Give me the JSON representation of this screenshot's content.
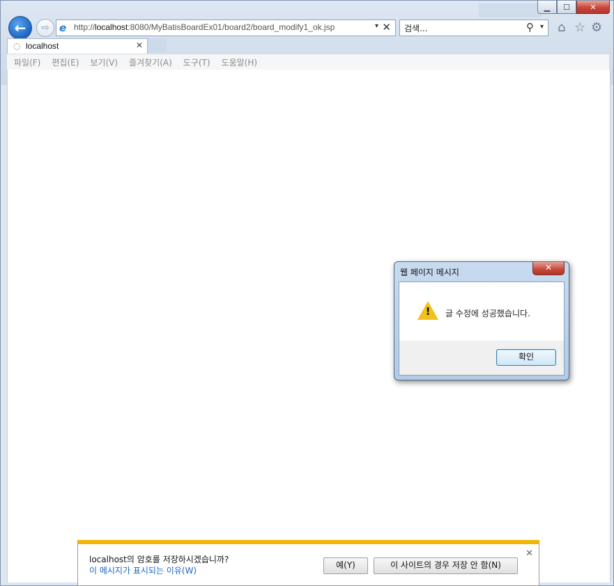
{
  "window": {
    "controls": {
      "minimize": "▁",
      "maximize": "☐",
      "close": "✕"
    }
  },
  "nav": {
    "back_glyph": "←",
    "forward_glyph": "⇨",
    "address": {
      "url_prefix": "http://",
      "url_host": "localhost",
      "url_rest": ":8080/MyBatisBoardEx01/board2/board_modify1_ok.jsp",
      "dropdown": "▾",
      "stop": "✕"
    },
    "search": {
      "placeholder": "검색...",
      "icon": "⚲",
      "dropdown": "▾"
    },
    "tools": {
      "home_icon": "⌂",
      "favorites_icon": "☆",
      "settings_icon": "⚙"
    }
  },
  "tab": {
    "label": "localhost",
    "spinner": "◌",
    "close": "✕"
  },
  "menu": [
    "파일(F)",
    "편집(E)",
    "보기(V)",
    "즐겨찾기(A)",
    "도구(T)",
    "도움말(H)"
  ],
  "dialog": {
    "title": "웹 페이지 메시지",
    "close": "✕",
    "icon": "warning-icon",
    "message": "글 수정에 성공했습니다.",
    "ok_label": "확인"
  },
  "notification": {
    "message": "localhost의 암호를 저장하시겠습니까?",
    "link": "이 메시지가 표시되는 이유(W)",
    "yes_label": "예(Y)",
    "no_label": "이 사이트의 경우 저장 안 함(N)",
    "close": "✕"
  },
  "colors": {
    "accent": "#1d64c2",
    "notification_bar": "#f4b400",
    "link": "#1a64c8"
  }
}
